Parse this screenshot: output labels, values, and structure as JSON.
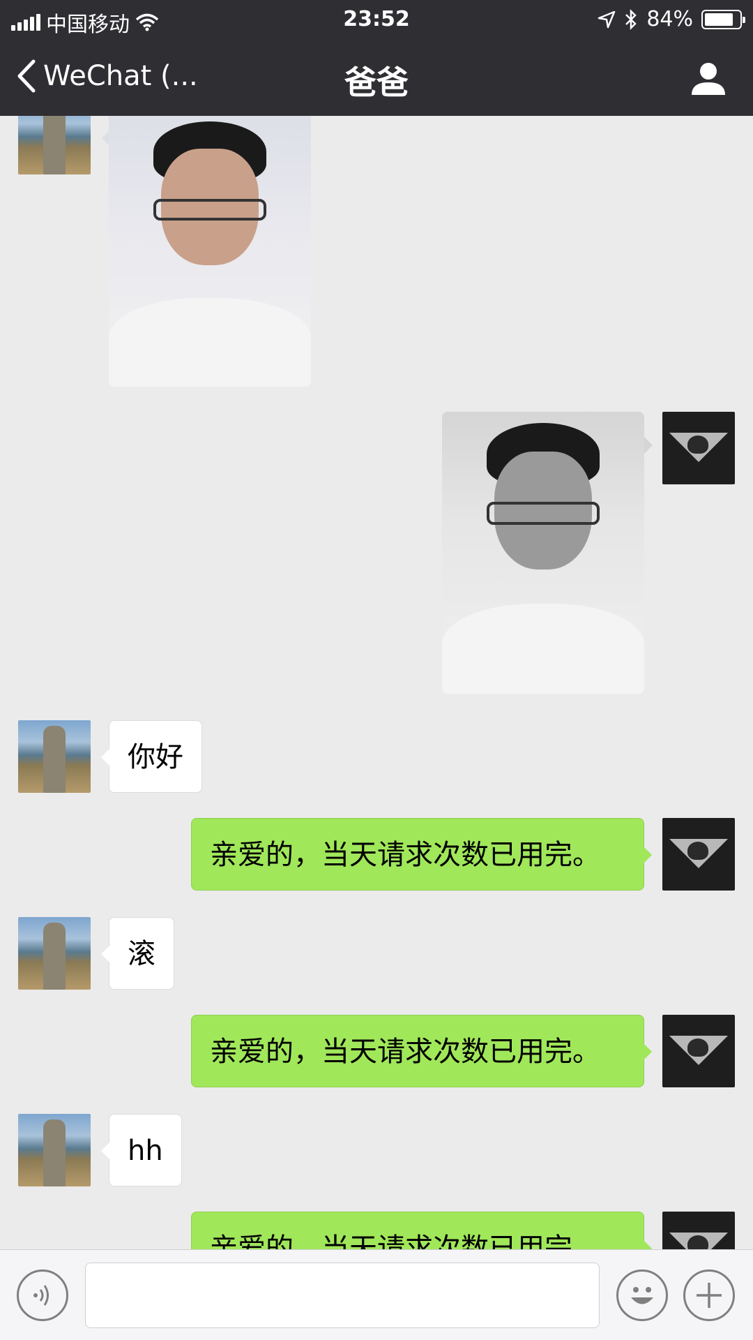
{
  "status_bar": {
    "carrier": "中国移动",
    "time": "23:52",
    "battery_percent": "84%",
    "battery_level": 0.84,
    "icons": [
      "signal-icon",
      "wifi-icon",
      "location-arrow-icon",
      "bluetooth-icon",
      "battery-icon"
    ]
  },
  "nav": {
    "back_label": "WeChat (...",
    "title": "爸爸",
    "profile_icon": "person-icon"
  },
  "messages": [
    {
      "side": "in",
      "type": "image"
    },
    {
      "side": "out",
      "type": "image"
    },
    {
      "side": "in",
      "type": "text",
      "text": "你好"
    },
    {
      "side": "out",
      "type": "text",
      "text": "亲爱的，当天请求次数已用完。"
    },
    {
      "side": "in",
      "type": "text",
      "text": "滚"
    },
    {
      "side": "out",
      "type": "text",
      "text": "亲爱的，当天请求次数已用完。"
    },
    {
      "side": "in",
      "type": "text",
      "text": "hh"
    },
    {
      "side": "out",
      "type": "text",
      "text": "亲爱的，当天请求次数已用完。"
    }
  ],
  "input_bar": {
    "value": "",
    "icons": [
      "voice-icon",
      "emoji-icon",
      "plus-icon"
    ]
  },
  "colors": {
    "header_bg": "#2e2e33",
    "chat_bg": "#ebebeb",
    "outgoing_bubble": "#a0e75a",
    "incoming_bubble": "#ffffff"
  }
}
